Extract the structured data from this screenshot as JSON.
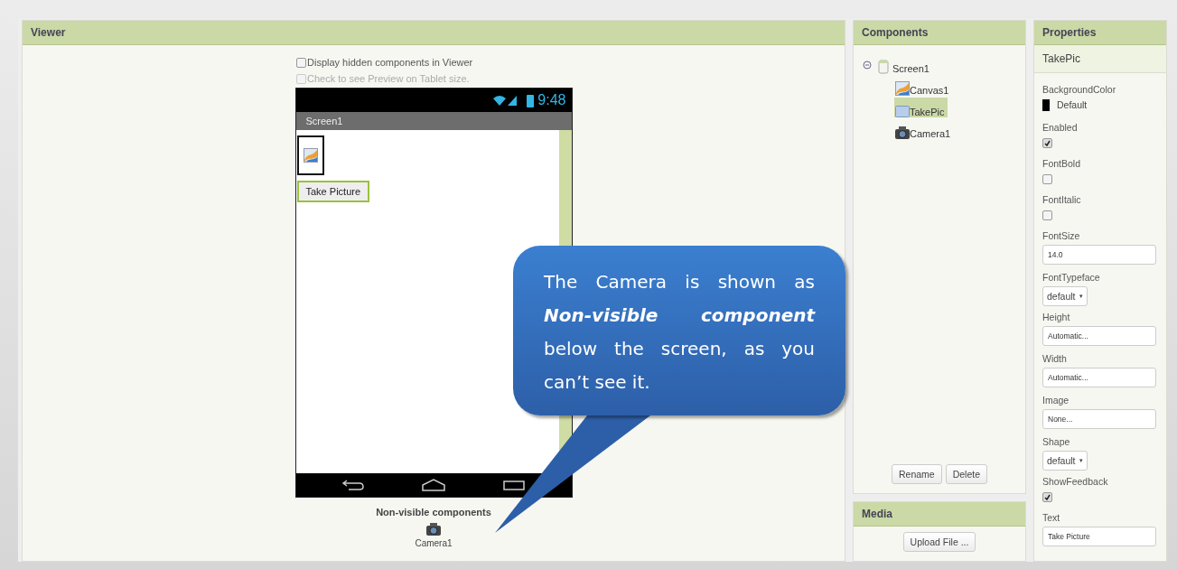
{
  "viewer": {
    "title": "Viewer",
    "options": [
      {
        "label": "Display hidden components in Viewer",
        "checked": false,
        "disabled": false
      },
      {
        "label": "Check to see Preview on Tablet size.",
        "checked": false,
        "disabled": true
      }
    ],
    "phone": {
      "time": "9:48",
      "screen_title": "Screen1",
      "button_label": "Take Picture",
      "button_selected": true
    },
    "nonvisible_title": "Non-visible components",
    "nonvisible_items": [
      {
        "label": "Camera1",
        "kind": "camera"
      }
    ]
  },
  "callout": {
    "text": "The Camera is shown as **Non-visible component** below the screen, as you can’t see it."
  },
  "components": {
    "title": "Components",
    "tree": [
      {
        "label": "Screen1",
        "kind": "screen",
        "selected": false,
        "expanded": true,
        "children": [
          {
            "label": "Canvas1",
            "kind": "canvas",
            "selected": false
          },
          {
            "label": "TakePic",
            "kind": "button",
            "selected": true
          },
          {
            "label": "Camera1",
            "kind": "camera",
            "selected": false
          }
        ]
      }
    ],
    "buttons": [
      "Rename",
      "Delete"
    ]
  },
  "media": {
    "title": "Media",
    "button": "Upload File ..."
  },
  "properties": {
    "title": "Properties",
    "component": "TakePic",
    "items": [
      {
        "label": "BackgroundColor",
        "kind": "color",
        "value": "Default",
        "color": "#000000"
      },
      {
        "label": "Enabled",
        "kind": "checkbox",
        "checked": true
      },
      {
        "label": "FontBold",
        "kind": "checkbox",
        "checked": false
      },
      {
        "label": "FontItalic",
        "kind": "checkbox",
        "checked": false
      },
      {
        "label": "FontSize",
        "kind": "text",
        "value": "14.0"
      },
      {
        "label": "FontTypeface",
        "kind": "dropdown",
        "value": "default",
        "caret": "▾"
      },
      {
        "label": "Height",
        "kind": "text",
        "value": "Automatic..."
      },
      {
        "label": "Width",
        "kind": "text",
        "value": "Automatic..."
      },
      {
        "label": "Image",
        "kind": "text",
        "value": "None..."
      },
      {
        "label": "Shape",
        "kind": "dropdown",
        "value": "default",
        "caret": "▾"
      },
      {
        "label": "ShowFeedback",
        "kind": "checkbox",
        "checked": true
      },
      {
        "label": "Text",
        "kind": "text",
        "value": "Take Picture"
      }
    ]
  }
}
